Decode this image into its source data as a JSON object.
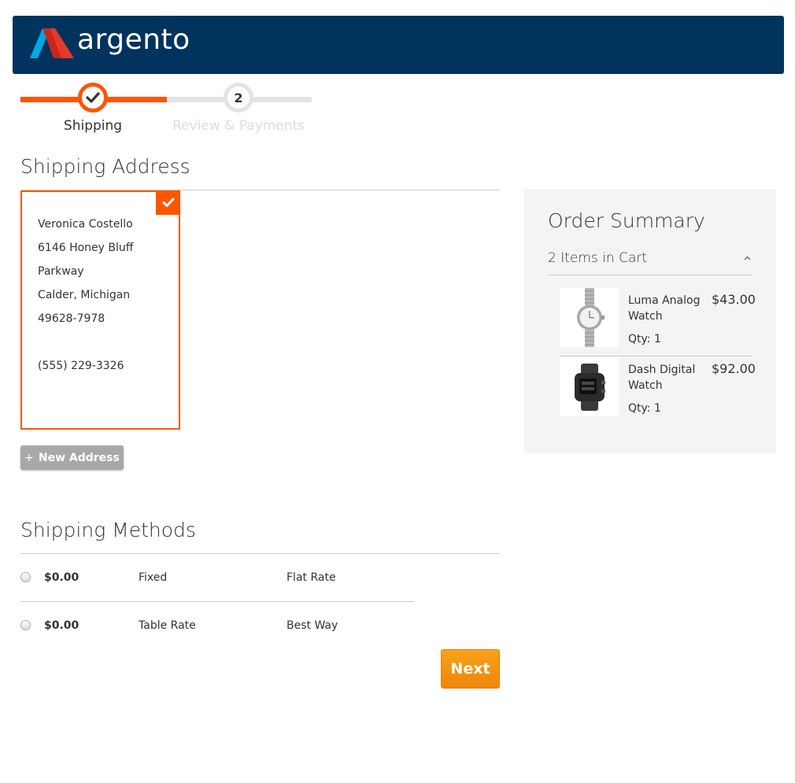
{
  "header": {
    "logo_text": "argento"
  },
  "progress": {
    "steps": [
      {
        "label": "Shipping",
        "status": "complete",
        "number": "1"
      },
      {
        "label": "Review & Payments",
        "status": "pending",
        "number": "2"
      }
    ]
  },
  "shipping_address": {
    "title": "Shipping Address",
    "selected": {
      "lines": [
        "Veronica Costello",
        "6146 Honey Bluff",
        "Parkway",
        "Calder, Michigan",
        "49628-7978",
        ""
      ],
      "phone": "(555) 229-3326"
    },
    "new_address_label": "New Address",
    "new_address_prefix": "+"
  },
  "shipping_methods": {
    "title": "Shipping Methods",
    "options": [
      {
        "price": "$0.00",
        "method": "Fixed",
        "carrier": "Flat Rate"
      },
      {
        "price": "$0.00",
        "method": "Table Rate",
        "carrier": "Best Way"
      }
    ]
  },
  "next_label": "Next",
  "order_summary": {
    "title": "Order Summary",
    "items_label": "2 Items in Cart",
    "items": [
      {
        "name": "Luma Analog Watch",
        "qty": "Qty: 1",
        "price": "$43.00"
      },
      {
        "name": "Dash Digital Watch",
        "qty": "Qty: 1",
        "price": "$92.00"
      }
    ]
  },
  "colors": {
    "brand_navy": "#00335e",
    "accent_orange": "#ff5501",
    "button_orange": "#f58a11",
    "summary_bg": "#f4f4f4"
  }
}
